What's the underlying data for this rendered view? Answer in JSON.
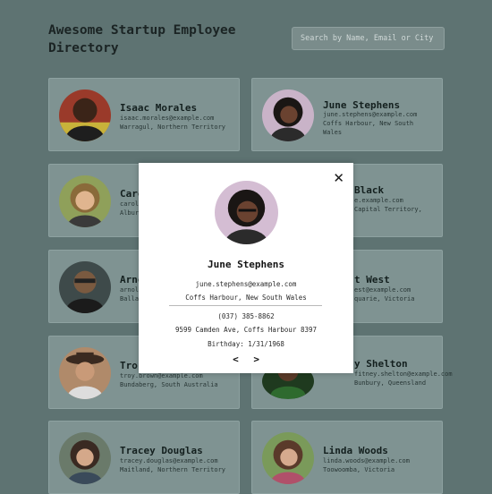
{
  "header": {
    "title": "Awesome Startup Employee Directory"
  },
  "search": {
    "placeholder": "Search by Name, Email or City"
  },
  "employees": [
    {
      "name": "Isaac Morales",
      "email": "isaac.morales@example.com",
      "location": "Warragul, Northern Territory"
    },
    {
      "name": "June Stephens",
      "email": "june.stephens@example.com",
      "location": "Coffs Harbour, New South Wales"
    },
    {
      "name": "Caro",
      "email": "carol",
      "location": "Albur"
    },
    {
      "name": "Black",
      "email": "e.example.com",
      "location": "Capital Territory,"
    },
    {
      "name": "Arno",
      "email": "arnol",
      "location": "Balla"
    },
    {
      "name": "t West",
      "email": "est@example.com",
      "location": "quarie, Victoria"
    },
    {
      "name": "Tro",
      "email": "troy.brown@example.com",
      "location": "Bundaberg, South Australia"
    },
    {
      "name": "y Shelton",
      "email": "fitney.shelton@example.com",
      "location": "Bunbury, Queensland"
    },
    {
      "name": "Tracey Douglas",
      "email": "tracey.douglas@example.com",
      "location": "Maitland, Northern Territory"
    },
    {
      "name": "Linda Woods",
      "email": "linda.woods@example.com",
      "location": "Toowoomba, Victoria"
    }
  ],
  "modal": {
    "close_label": "✕",
    "name": "June Stephens",
    "email": "june.stephens@example.com",
    "location": "Coffs Harbour, New South Wales",
    "phone": "(037) 385-8862",
    "address": "9599 Camden Ave, Coffs Harbour 8397",
    "birthday": "Birthday: 1/31/1968",
    "prev_label": "<",
    "next_label": ">"
  }
}
